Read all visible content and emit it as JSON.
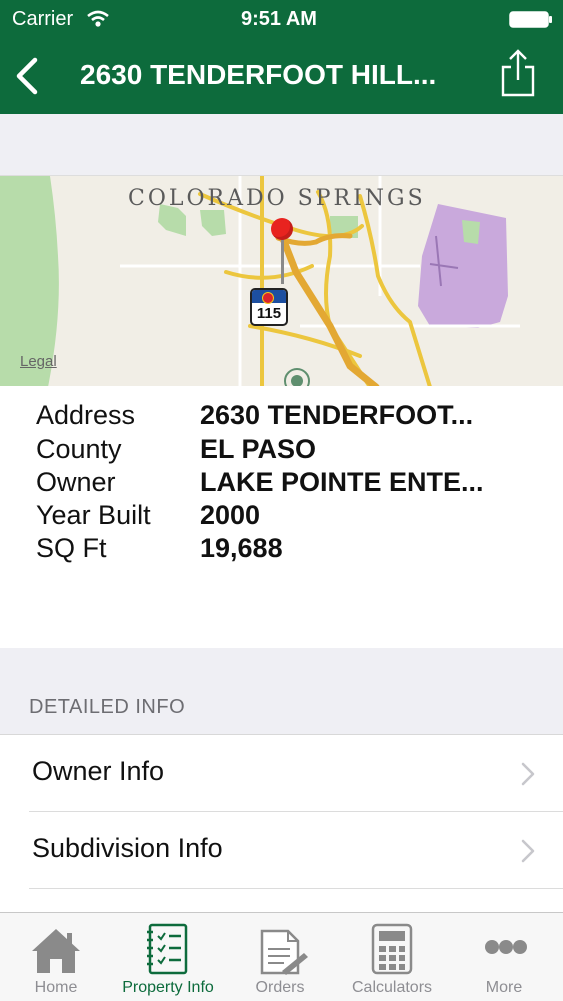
{
  "status_bar": {
    "carrier": "Carrier",
    "time": "9:51 AM"
  },
  "nav": {
    "title": "2630 TENDERFOOT HILL..."
  },
  "map": {
    "city_label": "COLORADO SPRINGS",
    "route_shield": "115",
    "legal": "Legal"
  },
  "property": {
    "rows": [
      {
        "label": "Address",
        "value": "2630 TENDERFOOT..."
      },
      {
        "label": "County",
        "value": "EL PASO"
      },
      {
        "label": "Owner",
        "value": "LAKE POINTE ENTE..."
      },
      {
        "label": "Year Built",
        "value": "2000"
      },
      {
        "label": "SQ Ft",
        "value": "19,688"
      }
    ]
  },
  "detailed": {
    "header": "DETAILED INFO",
    "items": [
      {
        "label": "Owner Info"
      },
      {
        "label": "Subdivision Info"
      }
    ]
  },
  "tabs": [
    {
      "label": "Home",
      "icon": "home-icon"
    },
    {
      "label": "Property Info",
      "icon": "property-info-icon",
      "active": true
    },
    {
      "label": "Orders",
      "icon": "orders-icon"
    },
    {
      "label": "Calculators",
      "icon": "calculator-icon"
    },
    {
      "label": "More",
      "icon": "more-icon"
    }
  ],
  "colors": {
    "brand_green": "#0d6b3c",
    "tab_inactive": "#8e8e93"
  }
}
